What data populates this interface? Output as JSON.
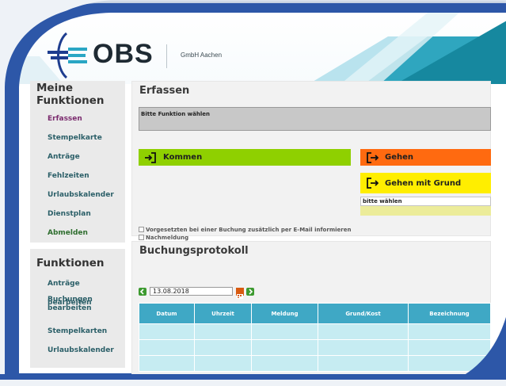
{
  "header": {
    "brand": "OBS",
    "company": "GmbH Aachen"
  },
  "sidebar": {
    "title": "Meine Funktionen",
    "items": [
      {
        "label": "Erfassen"
      },
      {
        "label": "Stempelkarte"
      },
      {
        "label": "Anträge"
      },
      {
        "label": "Fehlzeiten"
      },
      {
        "label": "Urlaubskalender"
      },
      {
        "label": "Dienstplan"
      },
      {
        "label": "Abmelden"
      }
    ],
    "section2_title": "Funktionen",
    "items2": [
      {
        "label": "Anträge bearbeiten"
      },
      {
        "label": "Buchungen bearbeiten"
      },
      {
        "label": "Stempelkarten"
      },
      {
        "label": "Urlaubskalender"
      }
    ]
  },
  "erfassen": {
    "title": "Erfassen",
    "info": "Bitte Funktion wählen",
    "kommen": "Kommen",
    "gehen": "Gehen",
    "gehen_grund": "Gehen mit Grund",
    "select_value": "bitte wählen",
    "check1": "Vorgesetzten bei einer Buchung zusätzlich per E-Mail informieren",
    "check2": "Nachmeldung"
  },
  "buchung": {
    "title": "Buchungsprotokoll",
    "date": "13.08.2018",
    "columns": [
      "Datum",
      "Uhrzeit",
      "Meldung",
      "Grund/Kost",
      "Bezeichnung"
    ]
  },
  "colors": {
    "frame": "#2d57a8",
    "kommen": "#8fd000",
    "gehen": "#ff6a10",
    "gehen_grund": "#ffee00",
    "table_header": "#3fa8c5",
    "table_cell": "#c6ecf2"
  }
}
